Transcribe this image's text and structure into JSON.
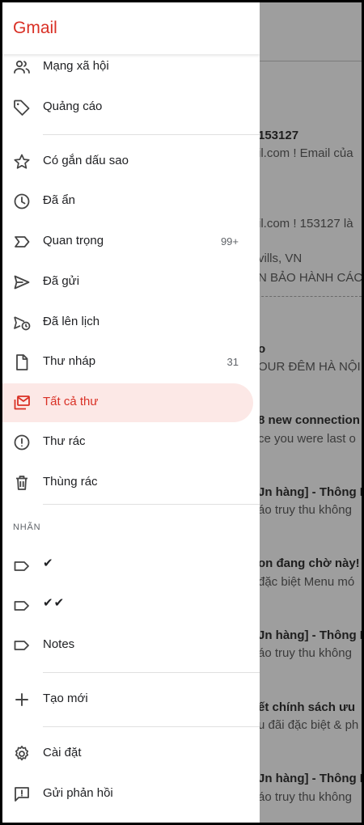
{
  "app": {
    "title": "Gmail"
  },
  "drawer": {
    "items_top": [
      {
        "label": "Mạng xã hội",
        "icon": "people-icon"
      },
      {
        "label": "Quảng cáo",
        "icon": "tag-icon"
      }
    ],
    "items_main": [
      {
        "label": "Có gắn dấu sao",
        "icon": "star-icon"
      },
      {
        "label": "Đã ẩn",
        "icon": "clock-icon"
      },
      {
        "label": "Quan trọng",
        "icon": "important-icon",
        "count": "99+"
      },
      {
        "label": "Đã gửi",
        "icon": "send-icon"
      },
      {
        "label": "Đã lên lịch",
        "icon": "scheduled-send-icon"
      },
      {
        "label": "Thư nháp",
        "icon": "draft-file-icon",
        "count": "31"
      },
      {
        "label": "Tất cả thư",
        "icon": "all-mail-icon",
        "selected": true
      },
      {
        "label": "Thư rác",
        "icon": "spam-icon"
      },
      {
        "label": "Thùng rác",
        "icon": "trash-icon"
      }
    ],
    "labels_header": "NHÃN",
    "labels": [
      {
        "label": "✔",
        "icon": "label-icon"
      },
      {
        "label": "✔✔",
        "icon": "label-icon"
      },
      {
        "label": "Notes",
        "icon": "label-icon"
      }
    ],
    "create": {
      "label": "Tạo mới",
      "icon": "plus-icon"
    },
    "bottom": [
      {
        "label": "Cài đặt",
        "icon": "settings-gear-icon"
      },
      {
        "label": "Gửi phản hồi",
        "icon": "feedback-icon"
      }
    ]
  },
  "inbox_background": {
    "lines": [
      {
        "text": "153127",
        "bold": true
      },
      {
        "text": "il.com ! Email của"
      },
      {
        "text": "il.com ! 153127 là"
      },
      {
        "text": "vills, VN"
      },
      {
        "text": "N BẢO HÀNH CÁC I"
      },
      {
        "text": "o",
        "bold": true
      },
      {
        "text": "OUR ĐÊM HÀ NỘI"
      },
      {
        "text": "8 new connection",
        "bold": true
      },
      {
        "text": "ce you were last o"
      },
      {
        "text": "Jn hàng] - Thông B",
        "bold": true
      },
      {
        "text": "áo truy thu không"
      },
      {
        "text": "on đang chờ này!",
        "bold": true
      },
      {
        "text": "đặc biệt Menu mó"
      },
      {
        "text": "Jn hàng] - Thông B",
        "bold": true
      },
      {
        "text": "áo truy thu không"
      },
      {
        "text": "ết  chính sách ưu",
        "bold": true
      },
      {
        "text": "u đãi đặc biệt & ph"
      },
      {
        "text": "Jn hàng] - Thông B",
        "bold": true
      },
      {
        "text": "áo truy thu không"
      }
    ]
  }
}
